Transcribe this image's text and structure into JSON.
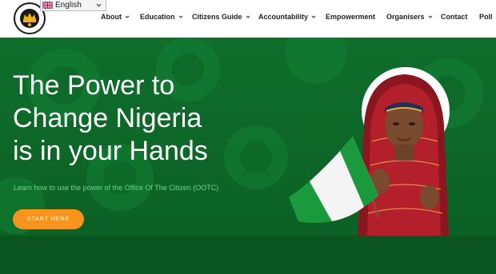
{
  "header": {
    "logo": {
      "text_top": "OFFICE OF",
      "text_bottom": "THE CITIZEN"
    },
    "language": {
      "selected": "English",
      "flag_icon": "uk-flag-icon"
    },
    "nav": [
      {
        "label": "About",
        "has_dropdown": true
      },
      {
        "label": "Education",
        "has_dropdown": true
      },
      {
        "label": "Citizens Guide",
        "has_dropdown": true
      },
      {
        "label": "Accountability",
        "has_dropdown": true
      },
      {
        "label": "Empowerment",
        "has_dropdown": false
      },
      {
        "label": "Organisers",
        "has_dropdown": true
      },
      {
        "label": "Contact",
        "has_dropdown": false
      },
      {
        "label": "Poll",
        "has_dropdown": false
      }
    ]
  },
  "hero": {
    "title_line1": "The Power to",
    "title_line2": "Change Nigeria",
    "title_line3": "is in your Hands",
    "subtitle": "Learn how to use the power of the Office Of The Citizen (OOTC)",
    "cta_label": "START HERE"
  },
  "colors": {
    "hero_green": "#0f6e2c",
    "accent_orange": "#f7941d",
    "subtitle_green": "#6fd28a",
    "nav_text": "#1f1f1f",
    "flag_green": "#1a9a3c"
  }
}
